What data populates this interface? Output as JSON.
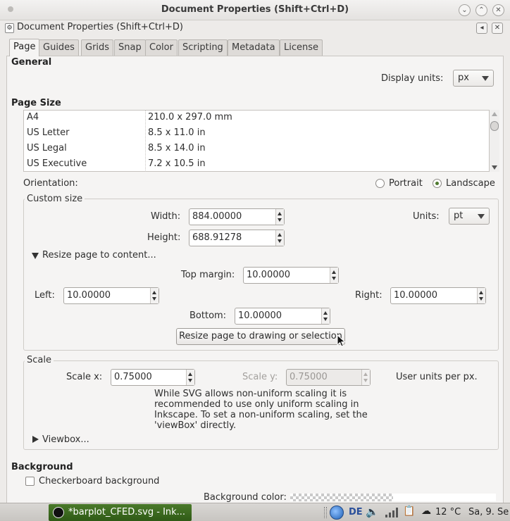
{
  "window": {
    "title": "Document Properties (Shift+Ctrl+D)"
  },
  "dock": {
    "title": "Document Properties (Shift+Ctrl+D)"
  },
  "tabs": [
    "Page",
    "Guides",
    "Grids",
    "Snap",
    "Color",
    "Scripting",
    "Metadata",
    "License"
  ],
  "general": {
    "heading": "General",
    "display_units_label": "Display units:",
    "display_units_value": "px"
  },
  "page_size": {
    "heading": "Page Size",
    "rows": [
      {
        "name": "A4",
        "size": "210.0 x 297.0 mm"
      },
      {
        "name": "US Letter",
        "size": "8.5 x 11.0 in"
      },
      {
        "name": "US Legal",
        "size": "8.5 x 14.0 in"
      },
      {
        "name": "US Executive",
        "size": "7.2 x 10.5 in"
      }
    ]
  },
  "orientation": {
    "label": "Orientation:",
    "portrait": "Portrait",
    "landscape": "Landscape",
    "selected": "landscape"
  },
  "custom_size": {
    "label": "Custom size",
    "width_label": "Width:",
    "width_value": "884.00000",
    "height_label": "Height:",
    "height_value": "688.91278",
    "units_label": "Units:",
    "units_value": "pt",
    "resize_expander": "Resize page to content...",
    "top_margin_label": "Top margin:",
    "top_margin_value": "10.00000",
    "left_label": "Left:",
    "left_value": "10.00000",
    "right_label": "Right:",
    "right_value": "10.00000",
    "bottom_label": "Bottom:",
    "bottom_value": "10.00000",
    "resize_button": "Resize page to drawing or selection"
  },
  "scale": {
    "label": "Scale",
    "scale_x_label": "Scale x:",
    "scale_x_value": "0.75000",
    "scale_y_label": "Scale y:",
    "scale_y_value": "0.75000",
    "user_units": "User units per px.",
    "note_lines": [
      "While SVG allows non-uniform scaling it is",
      "recommended to use only uniform scaling in",
      "Inkscape. To set a non-uniform scaling, set the",
      "'viewBox' directly."
    ],
    "viewbox_expander": "Viewbox..."
  },
  "background": {
    "heading": "Background",
    "checkerboard_label": "Checkerboard background",
    "color_label": "Background color:"
  },
  "taskbar": {
    "app_button": "*barplot_CFED.svg - Ink...",
    "keyboard_layout": "DE",
    "temperature": "12 °C",
    "clock": "Sa,  9. Se"
  }
}
